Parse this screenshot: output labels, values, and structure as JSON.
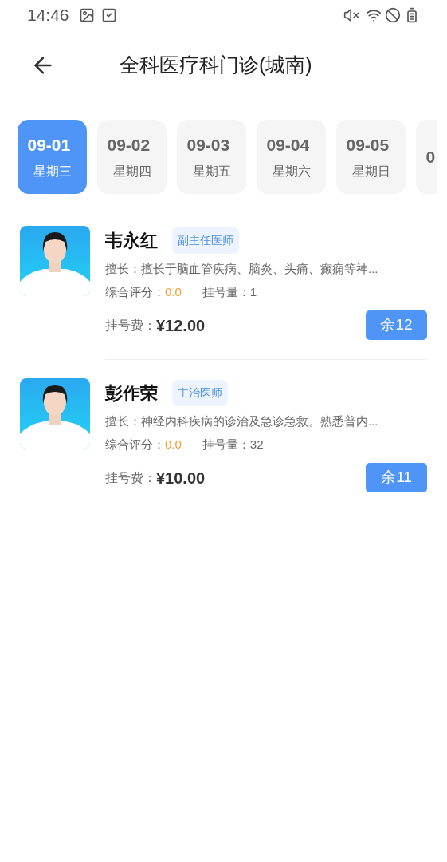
{
  "status_bar": {
    "time": "14:46"
  },
  "header": {
    "title": "全科医疗科门诊(城南)"
  },
  "dates": [
    {
      "date": "09-01",
      "weekday": "星期三",
      "selected": true
    },
    {
      "date": "09-02",
      "weekday": "星期四",
      "selected": false
    },
    {
      "date": "09-03",
      "weekday": "星期五",
      "selected": false
    },
    {
      "date": "09-04",
      "weekday": "星期六",
      "selected": false
    },
    {
      "date": "09-05",
      "weekday": "星期日",
      "selected": false
    },
    {
      "date": "0",
      "selected": false
    }
  ],
  "doctors": [
    {
      "name": "韦永红",
      "title": "副主任医师",
      "specialty": "擅长：擅长于脑血管疾病、脑炎、头痛、癫痫等神...",
      "rating_label": "综合评分：",
      "rating": "0.0",
      "count": "挂号量：1",
      "fee_label": "挂号费：",
      "fee": "¥12.00",
      "remaining": "余12"
    },
    {
      "name": "彭作荣",
      "title": "主治医师",
      "specialty": "擅长：神经内科疾病的诊治及急诊急救。熟悉普内...",
      "rating_label": "综合评分：",
      "rating": "0.0",
      "count": "挂号量：32",
      "fee_label": "挂号费：",
      "fee": "¥10.00",
      "remaining": "余11"
    }
  ]
}
